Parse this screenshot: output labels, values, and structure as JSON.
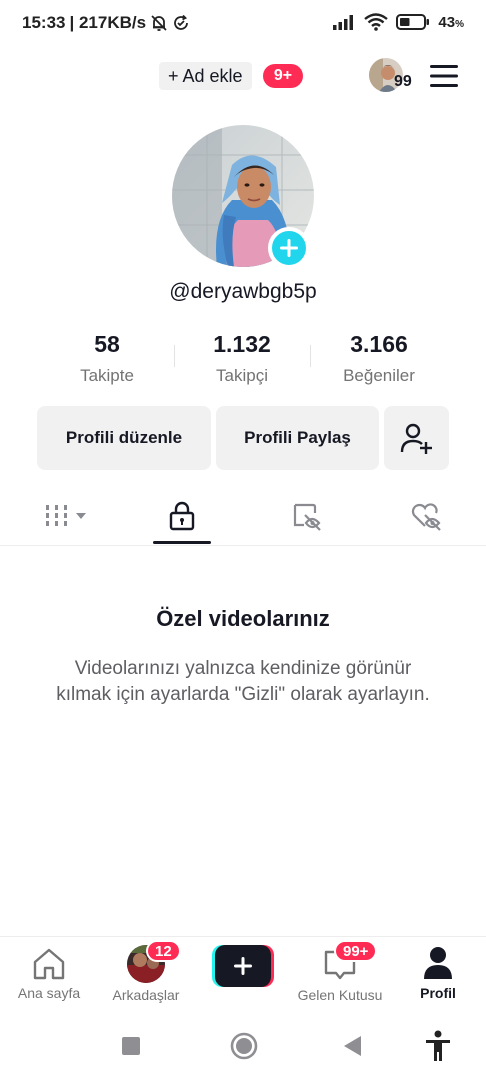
{
  "status_bar": {
    "time": "15:33",
    "network_speed": "| 217KB/s",
    "battery_percent": "43",
    "battery_unit": "%",
    "battery_level": 0.43,
    "icons": [
      "bell-off-icon",
      "sync-icon",
      "signal-icon",
      "wifi-icon",
      "battery-icon"
    ]
  },
  "header": {
    "add_account_label": "+ Ad ekle",
    "add_account_badge": "9+",
    "story_count": "99"
  },
  "profile": {
    "username": "@deryawbgb5p",
    "stats": [
      {
        "value": "58",
        "label": "Takipte"
      },
      {
        "value": "1.132",
        "label": "Takipçi"
      },
      {
        "value": "3.166",
        "label": "Beğeniler"
      }
    ],
    "edit_button": "Profili düzenle",
    "share_button": "Profili Paylaş"
  },
  "tabs": [
    {
      "icon": "grid-icon",
      "active": false
    },
    {
      "icon": "lock-icon",
      "active": true
    },
    {
      "icon": "tagged-icon",
      "active": false
    },
    {
      "icon": "liked-hidden-icon",
      "active": false
    }
  ],
  "empty_state": {
    "title": "Özel videolarınız",
    "description": "Videolarınızı yalnızca kendinize görünür kılmak için ayarlarda \"Gizli\" olarak ayarlayın."
  },
  "bottom_nav": {
    "home": "Ana sayfa",
    "friends": "Arkadaşlar",
    "friends_badge": "12",
    "inbox": "Gelen Kutusu",
    "inbox_badge": "99+",
    "profile": "Profil"
  },
  "colors": {
    "accent_red": "#fe2c55",
    "accent_cyan": "#20d5ec",
    "text_primary": "#161823",
    "button_bg": "#f1f1f2"
  }
}
